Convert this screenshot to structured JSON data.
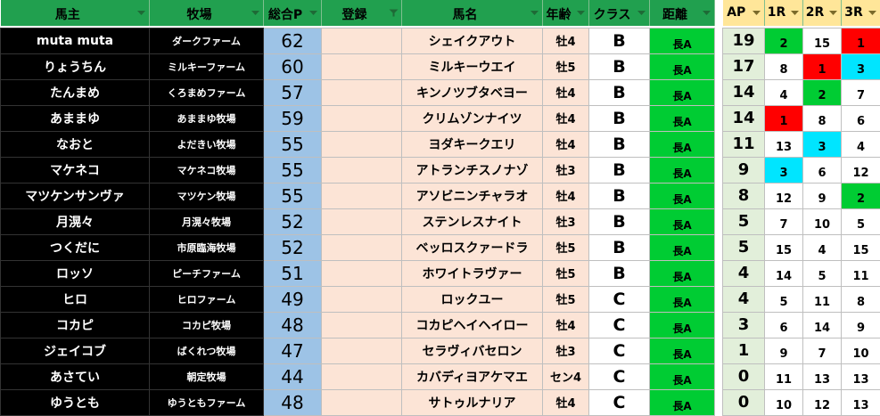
{
  "headers": {
    "owner": "馬主",
    "ranch": "牧場",
    "points": "総合P",
    "register": "登録",
    "horse": "馬名",
    "age": "年齢",
    "class": "クラス",
    "distance": "距離",
    "ap": "AP",
    "r1": "1R",
    "r2": "2R",
    "r3": "3R"
  },
  "icons": {
    "filter_dropdown": "filter-dropdown-icon",
    "filter_active": "filter-active-icon"
  },
  "colors": {
    "header_green": "#21a04f",
    "header_yellow": "#ffe699",
    "owner_black": "#000000",
    "points_blue": "#9dc3e6",
    "peach": "#fce4d6",
    "distance_green": "#00cc33",
    "ap_pale_green": "#e2efda",
    "rank_green": "#00cc33",
    "rank_red": "#ff0000",
    "rank_cyan": "#00e5ff"
  },
  "rows": [
    {
      "owner": "muta muta",
      "ranch": "ダークファーム",
      "points": "62",
      "horse": "シェイクアウト",
      "age": "牡4",
      "class": "B",
      "distance": "長A",
      "ap": "19",
      "r1": "2",
      "r2": "15",
      "r3": "1",
      "c1": "#00cc33",
      "c2": "#ffffff",
      "c3": "#ff0000"
    },
    {
      "owner": "りょうちん",
      "ranch": "ミルキーファーム",
      "points": "60",
      "horse": "ミルキーウエイ",
      "age": "牡5",
      "class": "B",
      "distance": "長A",
      "ap": "17",
      "r1": "8",
      "r2": "1",
      "r3": "3",
      "c1": "#ffffff",
      "c2": "#ff0000",
      "c3": "#00e5ff"
    },
    {
      "owner": "たんまめ",
      "ranch": "くろまめファーム",
      "points": "57",
      "horse": "キンノツブタベヨー",
      "age": "牡4",
      "class": "B",
      "distance": "長A",
      "ap": "14",
      "r1": "4",
      "r2": "2",
      "r3": "7",
      "c1": "#ffffff",
      "c2": "#00cc33",
      "c3": "#ffffff"
    },
    {
      "owner": "あままゆ",
      "ranch": "あままゆ牧場",
      "points": "59",
      "horse": "クリムゾンナイツ",
      "age": "牡4",
      "class": "B",
      "distance": "長A",
      "ap": "14",
      "r1": "1",
      "r2": "8",
      "r3": "6",
      "c1": "#ff0000",
      "c2": "#ffffff",
      "c3": "#ffffff"
    },
    {
      "owner": "なおと",
      "ranch": "よだきい牧場",
      "points": "55",
      "horse": "ヨダキークエリ",
      "age": "牡4",
      "class": "B",
      "distance": "長A",
      "ap": "11",
      "r1": "13",
      "r2": "3",
      "r3": "4",
      "c1": "#ffffff",
      "c2": "#00e5ff",
      "c3": "#ffffff"
    },
    {
      "owner": "マケネコ",
      "ranch": "マケネコ牧場",
      "points": "55",
      "horse": "アトランチスノナゾ",
      "age": "牡3",
      "class": "B",
      "distance": "長A",
      "ap": "9",
      "r1": "3",
      "r2": "6",
      "r3": "12",
      "c1": "#00e5ff",
      "c2": "#ffffff",
      "c3": "#ffffff"
    },
    {
      "owner": "マツケンサンヴァ",
      "ranch": "マツケン牧場",
      "points": "55",
      "horse": "アソビニンチャラオ",
      "age": "牡4",
      "class": "B",
      "distance": "長A",
      "ap": "8",
      "r1": "12",
      "r2": "9",
      "r3": "2",
      "c1": "#ffffff",
      "c2": "#ffffff",
      "c3": "#00cc33"
    },
    {
      "owner": "月滉々",
      "ranch": "月滉々牧場",
      "points": "52",
      "horse": "ステンレスナイト",
      "age": "牡3",
      "class": "B",
      "distance": "長A",
      "ap": "5",
      "r1": "7",
      "r2": "10",
      "r3": "5",
      "c1": "#ffffff",
      "c2": "#ffffff",
      "c3": "#ffffff"
    },
    {
      "owner": "つくだに",
      "ranch": "市原臨海牧場",
      "points": "52",
      "horse": "ベッロスクァードラ",
      "age": "牡5",
      "class": "B",
      "distance": "長A",
      "ap": "5",
      "r1": "15",
      "r2": "4",
      "r3": "15",
      "c1": "#ffffff",
      "c2": "#ffffff",
      "c3": "#ffffff"
    },
    {
      "owner": "ロッソ",
      "ranch": "ピーチファーム",
      "points": "51",
      "horse": "ホワイトラヴァー",
      "age": "牡5",
      "class": "B",
      "distance": "長A",
      "ap": "4",
      "r1": "14",
      "r2": "5",
      "r3": "11",
      "c1": "#ffffff",
      "c2": "#ffffff",
      "c3": "#ffffff"
    },
    {
      "owner": "ヒロ",
      "ranch": "ヒロファーム",
      "points": "49",
      "horse": "ロックユー",
      "age": "牡5",
      "class": "C",
      "distance": "長A",
      "ap": "4",
      "r1": "5",
      "r2": "11",
      "r3": "8",
      "c1": "#ffffff",
      "c2": "#ffffff",
      "c3": "#ffffff"
    },
    {
      "owner": "コカピ",
      "ranch": "コカピ牧場",
      "points": "48",
      "horse": "コカピヘイヘイロー",
      "age": "牡4",
      "class": "C",
      "distance": "長A",
      "ap": "3",
      "r1": "6",
      "r2": "14",
      "r3": "9",
      "c1": "#ffffff",
      "c2": "#ffffff",
      "c3": "#ffffff"
    },
    {
      "owner": "ジェイコブ",
      "ranch": "ばくれつ牧場",
      "points": "47",
      "horse": "セラヴィバセロン",
      "age": "牡3",
      "class": "C",
      "distance": "長A",
      "ap": "1",
      "r1": "9",
      "r2": "7",
      "r3": "10",
      "c1": "#ffffff",
      "c2": "#ffffff",
      "c3": "#ffffff"
    },
    {
      "owner": "あさてい",
      "ranch": "朝定牧場",
      "points": "44",
      "horse": "カバディヨアケマエ",
      "age": "セン4",
      "class": "C",
      "distance": "長A",
      "ap": "0",
      "r1": "11",
      "r2": "13",
      "r3": "13",
      "c1": "#ffffff",
      "c2": "#ffffff",
      "c3": "#ffffff"
    },
    {
      "owner": "ゆうとも",
      "ranch": "ゆうともファーム",
      "points": "48",
      "horse": "サトゥルナリア",
      "age": "牡4",
      "class": "C",
      "distance": "長A",
      "ap": "0",
      "r1": "10",
      "r2": "12",
      "r3": "13",
      "c1": "#ffffff",
      "c2": "#ffffff",
      "c3": "#ffffff"
    }
  ]
}
